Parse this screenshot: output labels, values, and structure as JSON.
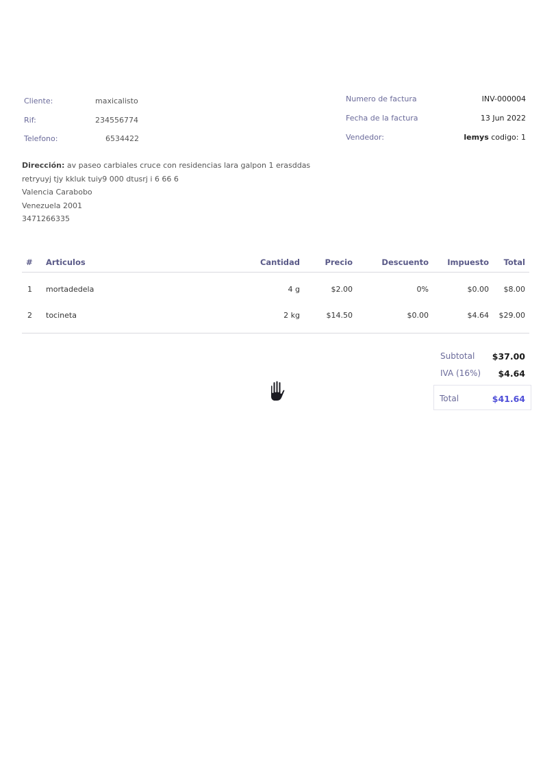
{
  "client": {
    "cliente_label": "Cliente:",
    "cliente_value": "maxicalisto",
    "rif_label": "Rif:",
    "rif_value": "234556774",
    "telefono_label": "Telefono:",
    "telefono_value": "6534422"
  },
  "invoice": {
    "numero_label": "Numero de factura",
    "numero_value": "INV-000004",
    "fecha_label": "Fecha de la factura",
    "fecha_value": "13 Jun 2022",
    "vendedor_label": "Vendedor:",
    "vendedor_name": "lemys",
    "vendedor_code": " codigo: 1"
  },
  "address": {
    "label": "Dirección:",
    "line1": " av paseo carbiales cruce con residencias lara galpon 1 erasddas",
    "line2": "retryuyj tjy kkluk tuiy9 000 dtusrj i 6 66 6",
    "line3": "Valencia Carabobo",
    "line4": "Venezuela 2001",
    "line5": "3471266335"
  },
  "table": {
    "headers": {
      "num": "#",
      "articulos": "Articulos",
      "cantidad": "Cantidad",
      "precio": "Precio",
      "descuento": "Descuento",
      "impuesto": "Impuesto",
      "total": "Total"
    },
    "rows": [
      {
        "num": "1",
        "articulo": "mortadedela",
        "cantidad": "4 g",
        "precio": "$2.00",
        "descuento": "0%",
        "impuesto": "$0.00",
        "total": "$8.00"
      },
      {
        "num": "2",
        "articulo": "tocineta",
        "cantidad": "2 kg",
        "precio": "$14.50",
        "descuento": "$0.00",
        "impuesto": "$4.64",
        "total": "$29.00"
      }
    ]
  },
  "totals": {
    "subtotal_label": "Subtotal",
    "subtotal_value": "$37.00",
    "iva_label": "IVA (16%)",
    "iva_value": "$4.64",
    "total_label": "Total",
    "total_value": "$41.64"
  },
  "colors": {
    "label": "#6a6a9a",
    "accent_total": "#5050d8"
  },
  "cursor_icon": "grab-hand-icon"
}
